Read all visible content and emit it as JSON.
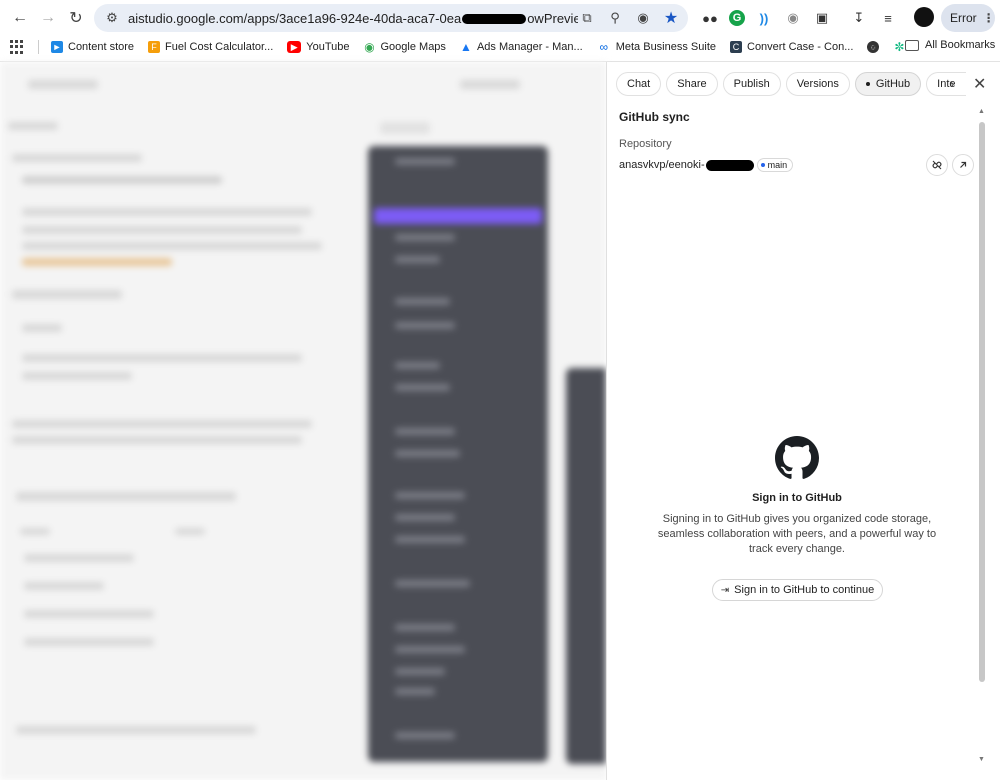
{
  "browser": {
    "url": "aistudio.google.com/apps/3ace1a96-924e-40da-aca7-0ea",
    "url_suffix": "owPreview=true&...",
    "profile_status": "Error"
  },
  "bookmarks": [
    {
      "label": "Content store",
      "icon": "content-store-icon",
      "color": "#1e88e5"
    },
    {
      "label": "Fuel Cost Calculator...",
      "icon": "fuel-icon",
      "color": "#f59e0b"
    },
    {
      "label": "YouTube",
      "icon": "youtube-icon",
      "color": "#ff0000"
    },
    {
      "label": "Google Maps",
      "icon": "maps-icon",
      "color": "#34a853"
    },
    {
      "label": "Ads Manager - Man...",
      "icon": "ads-manager-icon",
      "color": "#1877f2"
    },
    {
      "label": "Meta Business Suite",
      "icon": "meta-icon",
      "color": "#0668e1"
    },
    {
      "label": "Convert Case - Con...",
      "icon": "convert-case-icon",
      "color": "#2c3e50"
    }
  ],
  "bookmarks_all": "All Bookmarks",
  "panel": {
    "tabs": [
      {
        "label": "Chat",
        "active": false
      },
      {
        "label": "Share",
        "active": false
      },
      {
        "label": "Publish",
        "active": false
      },
      {
        "label": "Versions",
        "active": false
      },
      {
        "label": "GitHub",
        "active": true
      },
      {
        "label": "Inte",
        "active": false
      }
    ],
    "title": "GitHub sync",
    "repository_label": "Repository",
    "repository_name": "anasvkvp/eenoki-",
    "branch": "main",
    "signin_title": "Sign in to GitHub",
    "signin_description": "Signing in to GitHub gives you organized code storage, seamless collaboration with peers, and a powerful way to track every change.",
    "signin_button": "Sign in to GitHub to continue"
  },
  "colors": {
    "accent_star": "#1a57c4",
    "branch_dot": "#2563eb"
  }
}
